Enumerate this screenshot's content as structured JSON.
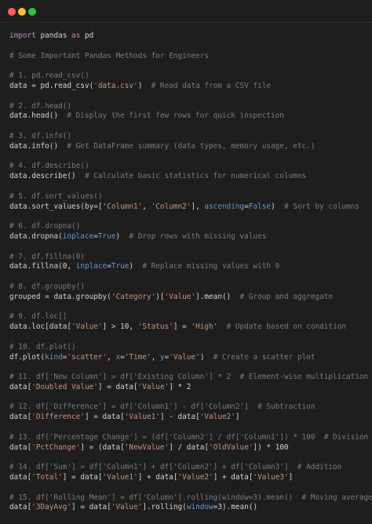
{
  "window": {
    "controls": {
      "close_color": "#ff5f56",
      "minimize_color": "#ffbd2e",
      "maximize_color": "#27c93f"
    }
  },
  "code_lines": [
    [
      {
        "t": "kw",
        "v": "import"
      },
      {
        "t": "tx",
        "v": " pandas "
      },
      {
        "t": "kw",
        "v": "as"
      },
      {
        "t": "tx",
        "v": " pd"
      }
    ],
    [],
    [
      {
        "t": "cm",
        "v": "# Some Important Pandas Methods for Engineers"
      }
    ],
    [],
    [
      {
        "t": "cm",
        "v": "# 1. pd.read_csv()"
      }
    ],
    [
      {
        "t": "tx",
        "v": "data = pd.read_csv("
      },
      {
        "t": "st",
        "v": "'data.csv'"
      },
      {
        "t": "tx",
        "v": ")  "
      },
      {
        "t": "cm",
        "v": "# Read data from a CSV file"
      }
    ],
    [],
    [
      {
        "t": "cm",
        "v": "# 2. df.head()"
      }
    ],
    [
      {
        "t": "tx",
        "v": "data.head()  "
      },
      {
        "t": "cm",
        "v": "# Display the first few rows for quick inspection"
      }
    ],
    [],
    [
      {
        "t": "cm",
        "v": "# 3. df.info()"
      }
    ],
    [
      {
        "t": "tx",
        "v": "data.info()  "
      },
      {
        "t": "cm",
        "v": "# Get DataFrame summary (data types, memory usage, etc.)"
      }
    ],
    [],
    [
      {
        "t": "cm",
        "v": "# 4. df.describe()"
      }
    ],
    [
      {
        "t": "tx",
        "v": "data.describe()  "
      },
      {
        "t": "cm",
        "v": "# Calculate basic statistics for numerical columns"
      }
    ],
    [],
    [
      {
        "t": "cm",
        "v": "# 5. df.sort_values()"
      }
    ],
    [
      {
        "t": "tx",
        "v": "data.sort_values(by=["
      },
      {
        "t": "st",
        "v": "'Column1'"
      },
      {
        "t": "tx",
        "v": ", "
      },
      {
        "t": "st",
        "v": "'Column2'"
      },
      {
        "t": "tx",
        "v": "], "
      },
      {
        "t": "bn",
        "v": "ascending"
      },
      {
        "t": "tx",
        "v": "="
      },
      {
        "t": "bn",
        "v": "False"
      },
      {
        "t": "tx",
        "v": ")  "
      },
      {
        "t": "cm",
        "v": "# Sort by columns"
      }
    ],
    [],
    [
      {
        "t": "cm",
        "v": "# 6. df.dropna()"
      }
    ],
    [
      {
        "t": "tx",
        "v": "data.dropna("
      },
      {
        "t": "bn",
        "v": "inplace"
      },
      {
        "t": "tx",
        "v": "="
      },
      {
        "t": "bn",
        "v": "True"
      },
      {
        "t": "tx",
        "v": ")  "
      },
      {
        "t": "cm",
        "v": "# Drop rows with missing values"
      }
    ],
    [],
    [
      {
        "t": "cm",
        "v": "# 7. df.fillna(0)"
      }
    ],
    [
      {
        "t": "tx",
        "v": "data.fillna(0, "
      },
      {
        "t": "bn",
        "v": "inplace"
      },
      {
        "t": "tx",
        "v": "="
      },
      {
        "t": "bn",
        "v": "True"
      },
      {
        "t": "tx",
        "v": ")  "
      },
      {
        "t": "cm",
        "v": "# Replace missing values with 0"
      }
    ],
    [],
    [
      {
        "t": "cm",
        "v": "# 8. df.groupby()"
      }
    ],
    [
      {
        "t": "tx",
        "v": "grouped = data.groupby("
      },
      {
        "t": "st",
        "v": "'Category'"
      },
      {
        "t": "tx",
        "v": ")["
      },
      {
        "t": "st",
        "v": "'Value'"
      },
      {
        "t": "tx",
        "v": "].mean()  "
      },
      {
        "t": "cm",
        "v": "# Group and aggregate"
      }
    ],
    [],
    [
      {
        "t": "cm",
        "v": "# 9. df.loc[]"
      }
    ],
    [
      {
        "t": "tx",
        "v": "data.loc[data["
      },
      {
        "t": "st",
        "v": "'Value'"
      },
      {
        "t": "tx",
        "v": "] > 10, "
      },
      {
        "t": "st",
        "v": "'Status'"
      },
      {
        "t": "tx",
        "v": "] = "
      },
      {
        "t": "st",
        "v": "'High'"
      },
      {
        "t": "tx",
        "v": "  "
      },
      {
        "t": "cm",
        "v": "# Update based on condition"
      }
    ],
    [],
    [
      {
        "t": "cm",
        "v": "# 10. df.plot()"
      }
    ],
    [
      {
        "t": "tx",
        "v": "df.plot("
      },
      {
        "t": "bn",
        "v": "kind"
      },
      {
        "t": "tx",
        "v": "="
      },
      {
        "t": "st",
        "v": "'scatter'"
      },
      {
        "t": "tx",
        "v": ", "
      },
      {
        "t": "bn",
        "v": "x"
      },
      {
        "t": "tx",
        "v": "="
      },
      {
        "t": "st",
        "v": "'Time'"
      },
      {
        "t": "tx",
        "v": ", "
      },
      {
        "t": "bn",
        "v": "y"
      },
      {
        "t": "tx",
        "v": "="
      },
      {
        "t": "st",
        "v": "'Value'"
      },
      {
        "t": "tx",
        "v": ")  "
      },
      {
        "t": "cm",
        "v": "# Create a scatter plot"
      }
    ],
    [],
    [
      {
        "t": "cm",
        "v": "# 11. df['New Column'] = df['Existing Column'] * 2  # Element-wise multiplication"
      }
    ],
    [
      {
        "t": "tx",
        "v": "data["
      },
      {
        "t": "st",
        "v": "'Doubled Value'"
      },
      {
        "t": "tx",
        "v": "] = data["
      },
      {
        "t": "st",
        "v": "'Value'"
      },
      {
        "t": "tx",
        "v": "] * 2"
      }
    ],
    [],
    [
      {
        "t": "cm",
        "v": "# 12. df['Difference'] = df['Column1'] - df['Column2']  # Subtraction"
      }
    ],
    [
      {
        "t": "tx",
        "v": "data["
      },
      {
        "t": "st",
        "v": "'Difference'"
      },
      {
        "t": "tx",
        "v": "] = data["
      },
      {
        "t": "st",
        "v": "'Value1'"
      },
      {
        "t": "tx",
        "v": "] - data["
      },
      {
        "t": "st",
        "v": "'Value2'"
      },
      {
        "t": "tx",
        "v": "]"
      }
    ],
    [],
    [
      {
        "t": "cm",
        "v": "# 13. df['Percentage Change'] = (df['Column2'] / df['Column1']) * 100  # Division"
      }
    ],
    [
      {
        "t": "tx",
        "v": "data["
      },
      {
        "t": "st",
        "v": "'PctChange'"
      },
      {
        "t": "tx",
        "v": "] = (data["
      },
      {
        "t": "st",
        "v": "'NewValue'"
      },
      {
        "t": "tx",
        "v": "] / data["
      },
      {
        "t": "st",
        "v": "'OldValue'"
      },
      {
        "t": "tx",
        "v": "]) * 100"
      }
    ],
    [],
    [
      {
        "t": "cm",
        "v": "# 14. df['Sum'] = df['Column1'] + df['Column2'] + df['Column3']  # Addition"
      }
    ],
    [
      {
        "t": "tx",
        "v": "data["
      },
      {
        "t": "st",
        "v": "'Total'"
      },
      {
        "t": "tx",
        "v": "] = data["
      },
      {
        "t": "st",
        "v": "'Value1'"
      },
      {
        "t": "tx",
        "v": "] + data["
      },
      {
        "t": "st",
        "v": "'Value2'"
      },
      {
        "t": "tx",
        "v": "] + data["
      },
      {
        "t": "st",
        "v": "'Value3'"
      },
      {
        "t": "tx",
        "v": "]"
      }
    ],
    [],
    [
      {
        "t": "cm",
        "v": "# 15. df['Rolling Mean'] = df['Column'].rolling(window=3).mean()  # Moving average"
      }
    ],
    [
      {
        "t": "tx",
        "v": "data["
      },
      {
        "t": "st",
        "v": "'3DayAvg'"
      },
      {
        "t": "tx",
        "v": "] = data["
      },
      {
        "t": "st",
        "v": "'Value'"
      },
      {
        "t": "tx",
        "v": "].rolling("
      },
      {
        "t": "bn",
        "v": "window"
      },
      {
        "t": "tx",
        "v": "=3).mean()"
      }
    ]
  ]
}
